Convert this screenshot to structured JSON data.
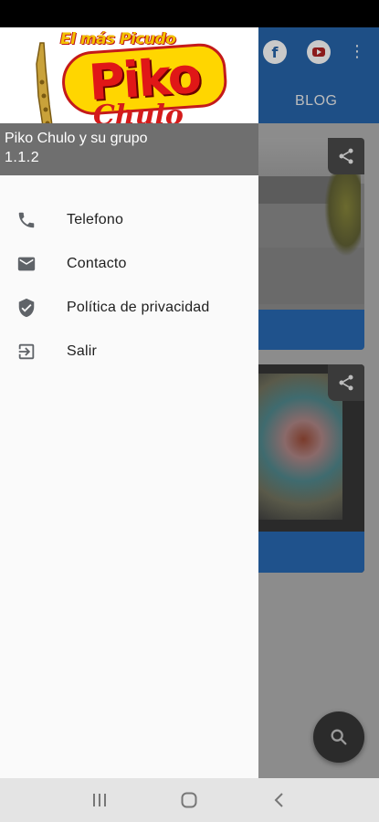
{
  "logo": {
    "tagline": "El más Picudo",
    "brand": "Piko",
    "sub": "Chulo"
  },
  "app_info": {
    "name": "Piko Chulo y su grupo",
    "version": "1.1.2"
  },
  "menu": {
    "items": [
      {
        "label": "Telefono",
        "icon": "phone-icon"
      },
      {
        "label": "Contacto",
        "icon": "mail-icon"
      },
      {
        "label": "Política de privacidad",
        "icon": "shield-icon"
      },
      {
        "label": "Salir",
        "icon": "exit-icon"
      }
    ]
  },
  "background_app": {
    "tab_label": "BLOG",
    "social_icons": [
      "facebook-icon",
      "youtube-icon",
      "more-vert-icon"
    ]
  },
  "colors": {
    "toolbar": "#1e4f86",
    "drawer_bg": "#fafafa",
    "app_info_bg": "#6f6f6f",
    "logo_yellow": "#ffd600",
    "logo_red": "#e01717"
  }
}
